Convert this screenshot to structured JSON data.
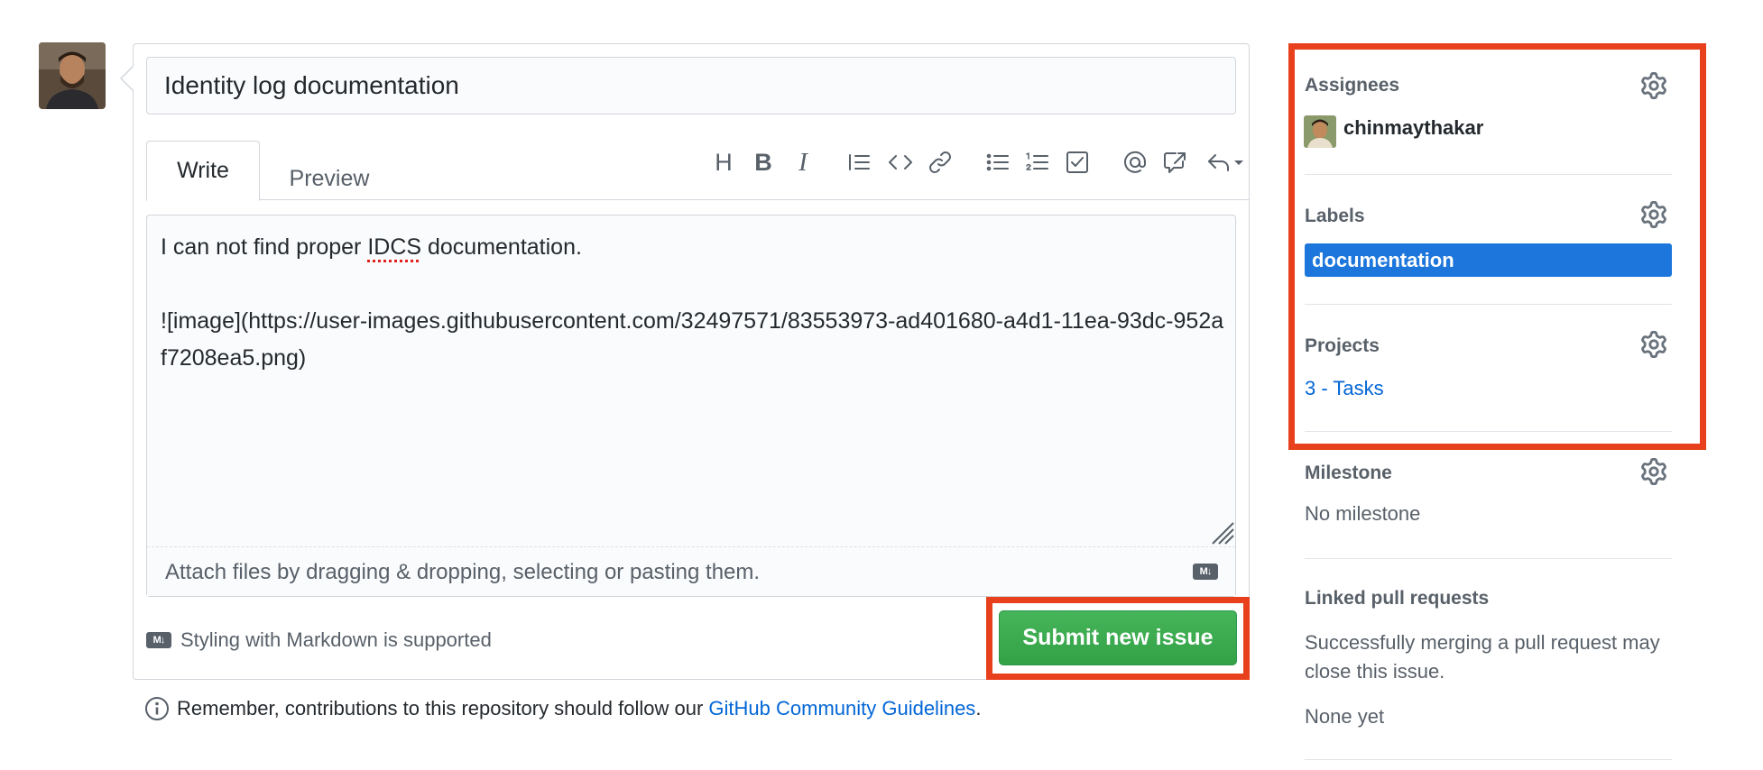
{
  "issue": {
    "title_value": "Identity log documentation",
    "body_line1_before": "I can not find proper ",
    "body_line1_flagged": "IDCS",
    "body_line1_after": " documentation.",
    "body_image_markdown": "![image](https://user-images.githubusercontent.com/32497571/83553973-ad401680-a4d1-11ea-93dc-952af7208ea5.png)",
    "attach_hint": "Attach files by dragging & dropping, selecting or pasting them.",
    "markdown_note": "Styling with Markdown is supported",
    "submit_label": "Submit new issue"
  },
  "tabs": {
    "write": "Write",
    "preview": "Preview"
  },
  "toolbar": {
    "heading_glyph": "H",
    "bold_glyph": "B",
    "italic_glyph": "I",
    "icons": [
      "heading-icon",
      "bold-icon",
      "italic-icon",
      "quote-icon",
      "code-icon",
      "link-icon",
      "bulleted-list-icon",
      "numbered-list-icon",
      "task-list-icon",
      "mention-icon",
      "reference-icon",
      "reply-icon"
    ]
  },
  "footer": {
    "guidelines_prefix": "Remember, contributions to this repository should follow our ",
    "guidelines_link": "GitHub Community Guidelines",
    "guidelines_suffix": "."
  },
  "sidebar": {
    "assignees": {
      "title": "Assignees",
      "user": "chinmaythakar"
    },
    "labels": {
      "title": "Labels",
      "label": "documentation",
      "label_color": "#1d76db"
    },
    "projects": {
      "title": "Projects",
      "project": "3 - Tasks"
    },
    "milestone": {
      "title": "Milestone",
      "value": "No milestone"
    },
    "linked_prs": {
      "title": "Linked pull requests",
      "description": "Successfully merging a pull request may close this issue.",
      "value": "None yet"
    }
  },
  "colors": {
    "submit_green": "#34a246",
    "highlight_red": "#e8401c",
    "link_blue": "#0366d6"
  }
}
